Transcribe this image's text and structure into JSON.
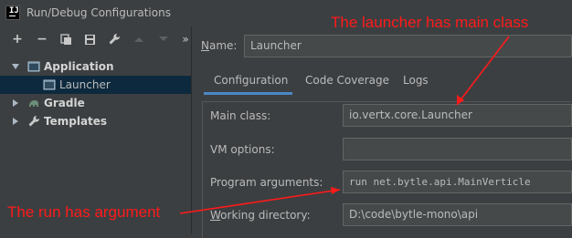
{
  "window": {
    "title": "Run/Debug Configurations"
  },
  "toolbar": {
    "add": "+",
    "remove": "−",
    "copy": "copy-icon",
    "save": "save-icon",
    "edit": "wrench-icon",
    "up": "up-icon",
    "down": "down-icon",
    "more": "»"
  },
  "tree": {
    "items": [
      {
        "label": "Application",
        "icon": "application-icon",
        "expanded": true
      },
      {
        "label": "Launcher",
        "icon": "launcher-icon",
        "selected": true
      },
      {
        "label": "Gradle",
        "icon": "gradle-icon",
        "expanded": false
      },
      {
        "label": "Templates",
        "icon": "wrench-icon",
        "expanded": false
      }
    ]
  },
  "config": {
    "name_label_prefix": "N",
    "name_label_rest": "ame:",
    "name_value": "Launcher",
    "tabs": [
      "Configuration",
      "Code Coverage",
      "Logs"
    ],
    "fields": {
      "main_class_label": "Main class:",
      "main_class_value": "io.vertx.core.Launcher",
      "vm_options_label": "VM options:",
      "vm_options_value": "",
      "program_args_label": "Program arguments:",
      "program_args_value": "run net.bytle.api.MainVerticle",
      "working_dir_label_prefix": "W",
      "working_dir_label_rest": "orking directory:",
      "working_dir_value": "D:\\code\\bytle-mono\\api"
    }
  },
  "annotations": {
    "main_class_note": "The launcher has main class",
    "run_note": "The run has argument",
    "color": "#ff1a1a"
  },
  "colors": {
    "background": "#3c3f41",
    "selection": "#0d293e",
    "tab_underline": "#4a88c7",
    "field_background": "#45494a"
  }
}
